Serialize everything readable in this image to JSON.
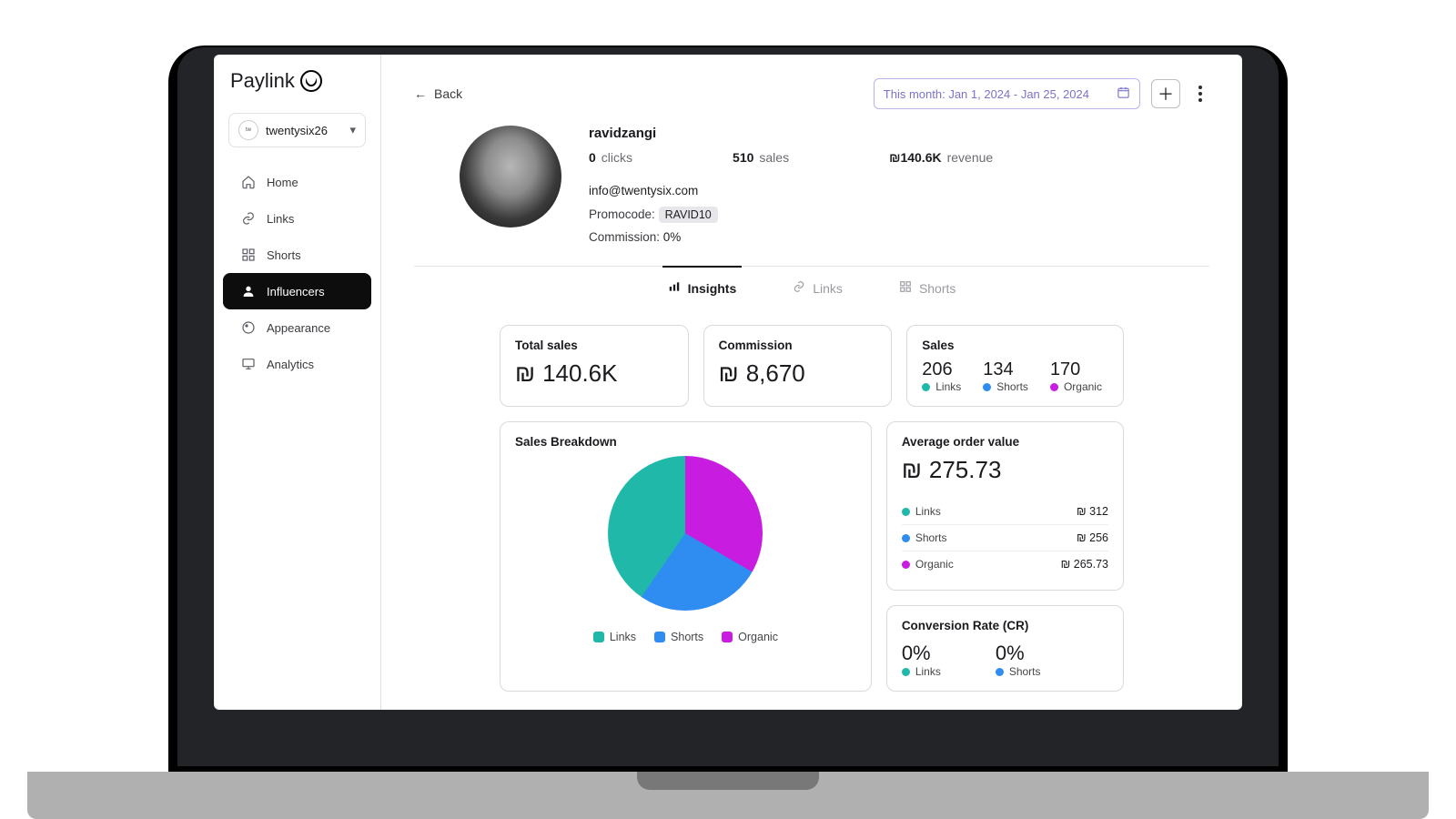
{
  "brand": "Paylink",
  "workspace": {
    "name": "twentysix26"
  },
  "nav": {
    "home": "Home",
    "links": "Links",
    "shorts": "Shorts",
    "influencers": "Influencers",
    "appearance": "Appearance",
    "analytics": "Analytics"
  },
  "topbar": {
    "back": "Back",
    "date_range": "This month: Jan 1, 2024 - Jan 25, 2024"
  },
  "profile": {
    "username": "ravidzangi",
    "clicks_value": "0",
    "clicks_label": "clicks",
    "sales_value": "510",
    "sales_label": "sales",
    "revenue_value": "₪140.6K",
    "revenue_label": "revenue",
    "email": "info@twentysix.com",
    "promocode_label": "Promocode:",
    "promocode": "RAVID10",
    "commission_label": "Commission:",
    "commission_value": "0%"
  },
  "tabs": {
    "insights": "Insights",
    "links": "Links",
    "shorts": "Shorts"
  },
  "cards": {
    "total_sales": {
      "title": "Total sales",
      "value": "140.6K",
      "currency": "₪"
    },
    "commission": {
      "title": "Commission",
      "value": "8,670",
      "currency": "₪"
    },
    "sales": {
      "title": "Sales",
      "links": {
        "value": "206",
        "label": "Links"
      },
      "shorts": {
        "value": "134",
        "label": "Shorts"
      },
      "organic": {
        "value": "170",
        "label": "Organic"
      }
    },
    "breakdown": {
      "title": "Sales Breakdown",
      "links": "Links",
      "shorts": "Shorts",
      "organic": "Organic"
    },
    "aov": {
      "title": "Average order value",
      "currency": "₪",
      "value": "275.73",
      "rows": [
        {
          "label": "Links",
          "color": "teal",
          "value": "₪ 312"
        },
        {
          "label": "Shorts",
          "color": "blue",
          "value": "₪ 256"
        },
        {
          "label": "Organic",
          "color": "magenta",
          "value": "₪ 265.73"
        }
      ]
    },
    "cr": {
      "title": "Conversion Rate (CR)",
      "links": {
        "value": "0%",
        "label": "Links"
      },
      "shorts": {
        "value": "0%",
        "label": "Shorts"
      }
    }
  },
  "colors": {
    "teal": "#20b9a9",
    "blue": "#2f8cf0",
    "magenta": "#c81de0"
  },
  "chart_data": {
    "type": "pie",
    "title": "Sales Breakdown",
    "series": [
      {
        "name": "Links",
        "value": 206,
        "color": "#20b9a9"
      },
      {
        "name": "Shorts",
        "value": 134,
        "color": "#2f8cf0"
      },
      {
        "name": "Organic",
        "value": 170,
        "color": "#c81de0"
      }
    ]
  }
}
